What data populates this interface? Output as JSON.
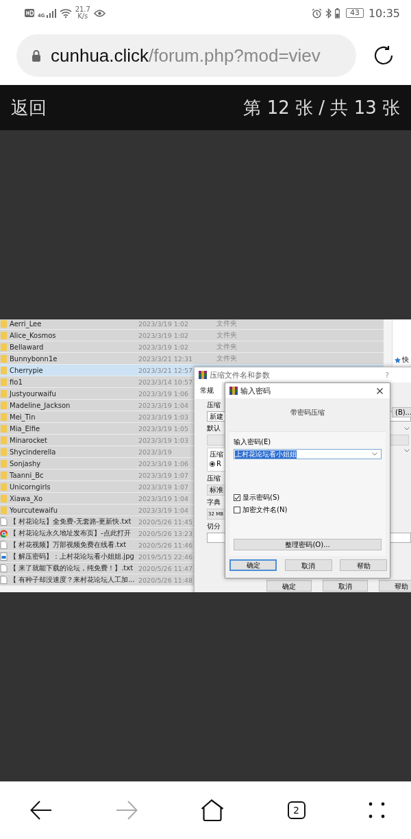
{
  "status_bar": {
    "network": "4G",
    "net_speed": "21.7",
    "net_unit": "K/s",
    "battery": "43",
    "time": "10:35"
  },
  "address_bar": {
    "domain": "cunhua.click",
    "path": "/forum.php?mod=viev"
  },
  "viewer_header": {
    "back": "返回",
    "counter": "第 12 张 / 共 13 张"
  },
  "image": {
    "file_list": {
      "rows": [
        {
          "kind": "folder",
          "name": "Aerri_Lee",
          "date": "2023/3/19 1:02",
          "type": "文件夹",
          "selected": false
        },
        {
          "kind": "folder",
          "name": "Alice_Kosmos",
          "date": "2023/3/19 1:02",
          "type": "文件夹",
          "selected": false
        },
        {
          "kind": "folder",
          "name": "Bellaward",
          "date": "2023/3/19 1:02",
          "type": "文件夹",
          "selected": false
        },
        {
          "kind": "folder",
          "name": "Bunnybonn1e",
          "date": "2023/3/21 12:31",
          "type": "文件夹",
          "selected": false
        },
        {
          "kind": "folder",
          "name": "Cherrypie",
          "date": "2023/3/21 12:57",
          "selected": true
        },
        {
          "kind": "folder",
          "name": "fio1",
          "date": "2023/3/14 10:57",
          "selected": false
        },
        {
          "kind": "folder",
          "name": "Justyourwaifu",
          "date": "2023/3/19 1:06",
          "selected": false
        },
        {
          "kind": "folder",
          "name": "Madeline_Jackson",
          "date": "2023/3/19 1:04",
          "selected": false
        },
        {
          "kind": "folder",
          "name": "Mei_Tin",
          "date": "2023/3/19 1:03",
          "selected": false
        },
        {
          "kind": "folder",
          "name": "Mia_Elfie",
          "date": "2023/3/19 1:05",
          "selected": false
        },
        {
          "kind": "folder",
          "name": "Minarocket",
          "date": "2023/3/19 1:03",
          "selected": false
        },
        {
          "kind": "folder",
          "name": "Shycinderella",
          "date": "2023/3/19",
          "selected": false
        },
        {
          "kind": "folder",
          "name": "Sonjashy",
          "date": "2023/3/19 1:06",
          "selected": false
        },
        {
          "kind": "folder",
          "name": "Taanni_Bc",
          "date": "2023/3/19 1:07",
          "selected": false
        },
        {
          "kind": "folder",
          "name": "Unicorngirls",
          "date": "2023/3/19 1:07",
          "selected": false
        },
        {
          "kind": "folder",
          "name": "Xiawa_Xo",
          "date": "2023/3/19 1:04",
          "selected": false
        },
        {
          "kind": "folder",
          "name": "Yourcutewaifu",
          "date": "2023/3/19 1:04",
          "selected": false
        },
        {
          "kind": "text",
          "name": "【 村花论坛】全免费-无套路-更新快.txt",
          "date": "2020/5/26 11:45",
          "selected": false
        },
        {
          "kind": "web",
          "name": "【 村花论坛永久地址发布页】-点此打开",
          "date": "2020/5/26 13:23",
          "selected": false
        },
        {
          "kind": "text",
          "name": "【 村花视频】万部视频免费在线看.txt",
          "date": "2020/5/26 11:46",
          "selected": false
        },
        {
          "kind": "image",
          "name": "【 解压密码】：上村花论坛看小姐姐.jpg",
          "date": "2019/5/15 22:46",
          "selected": false
        },
        {
          "kind": "text",
          "name": "【 来了就能下载的论坛，纯免费！】.txt",
          "date": "2020/5/26 11:47",
          "selected": false
        },
        {
          "kind": "text",
          "name": "【 有种子却没速度？来村花论坛人工加...",
          "date": "2020/5/26 11:48",
          "selected": false
        }
      ]
    },
    "side_panel": {
      "label": "快"
    },
    "archive_dialog": {
      "title": "压缩文件名和参数",
      "help": "?",
      "tab": "常规",
      "name_label": "压缩",
      "name_value": "新建",
      "profile_label": "默认",
      "format_label": "压缩",
      "format_option": {
        "label": "R",
        "selected": true
      },
      "method_label": "压缩",
      "method_value": "标准",
      "dict_label": "字典",
      "dict_value": "32 MB",
      "split_label": "切分",
      "browse_button": "(B)...",
      "buttons": [
        "确定",
        "取消",
        "帮助"
      ]
    },
    "password_dialog": {
      "title": "输入密码",
      "heading": "带密码压缩",
      "password_label": "输入密码(E)",
      "password_value": "上村花论坛看小姐姐",
      "options": [
        {
          "label": "显示密码(S)",
          "checked": true
        },
        {
          "label": "加密文件名(N)",
          "checked": false
        }
      ],
      "organize_button": "整理密码(O)...",
      "buttons": [
        {
          "label": "确定",
          "selected": true
        },
        {
          "label": "取消",
          "selected": false
        },
        {
          "label": "帮助",
          "selected": false
        }
      ]
    }
  },
  "bottom_nav": {
    "items": [
      {
        "kind": "back",
        "disabled": false
      },
      {
        "kind": "forward",
        "disabled": true
      },
      {
        "kind": "home",
        "disabled": false
      },
      {
        "kind": "tabs",
        "count": "2",
        "disabled": false
      },
      {
        "kind": "menu",
        "disabled": false
      }
    ]
  }
}
